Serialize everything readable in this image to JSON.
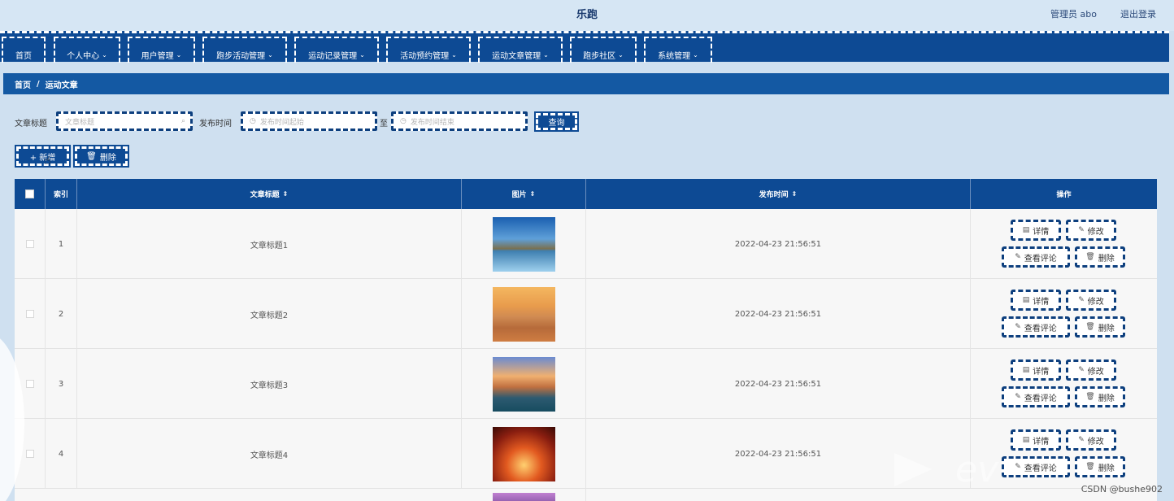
{
  "app": {
    "title": "乐跑",
    "user": "管理员 abo",
    "logout": "退出登录"
  },
  "nav": [
    {
      "label": "首页",
      "has_chevron": false
    },
    {
      "label": "个人中心",
      "has_chevron": true
    },
    {
      "label": "用户管理",
      "has_chevron": true
    },
    {
      "label": "跑步活动管理",
      "has_chevron": true
    },
    {
      "label": "运动记录管理",
      "has_chevron": true
    },
    {
      "label": "活动预约管理",
      "has_chevron": true
    },
    {
      "label": "运动文章管理",
      "has_chevron": true
    },
    {
      "label": "跑步社区",
      "has_chevron": true
    },
    {
      "label": "系统管理",
      "has_chevron": true
    }
  ],
  "breadcrumb": {
    "home": "首页",
    "sep": "/",
    "current": "运动文章"
  },
  "filters": {
    "title_label": "文章标题",
    "title_placeholder": "文章标题",
    "time_label": "发布时间",
    "start_placeholder": "发布时间起始",
    "to": "至",
    "end_placeholder": "发布时间结束",
    "query": "查询"
  },
  "actions": {
    "add": "+ 新增",
    "delete": "删除"
  },
  "table": {
    "headers": {
      "index": "索引",
      "title": "文章标题",
      "image": "图片",
      "time": "发布时间",
      "ops": "操作"
    },
    "rows": [
      {
        "index": "1",
        "title": "文章标题1",
        "time": "2022-04-23 21:56:51"
      },
      {
        "index": "2",
        "title": "文章标题2",
        "time": "2022-04-23 21:56:51"
      },
      {
        "index": "3",
        "title": "文章标题3",
        "time": "2022-04-23 21:56:51"
      },
      {
        "index": "4",
        "title": "文章标题4",
        "time": "2022-04-23 21:56:51"
      }
    ],
    "op_labels": {
      "detail": "详情",
      "edit": "修改",
      "comments": "查看评论",
      "delete": "删除"
    }
  },
  "watermark": {
    "csdn": "CSDN @bushe902",
    "brand": "ev"
  },
  "colors": {
    "primary": "#0d4a94",
    "background": "#cfe0f0",
    "breadcrumb": "#1459a3"
  }
}
